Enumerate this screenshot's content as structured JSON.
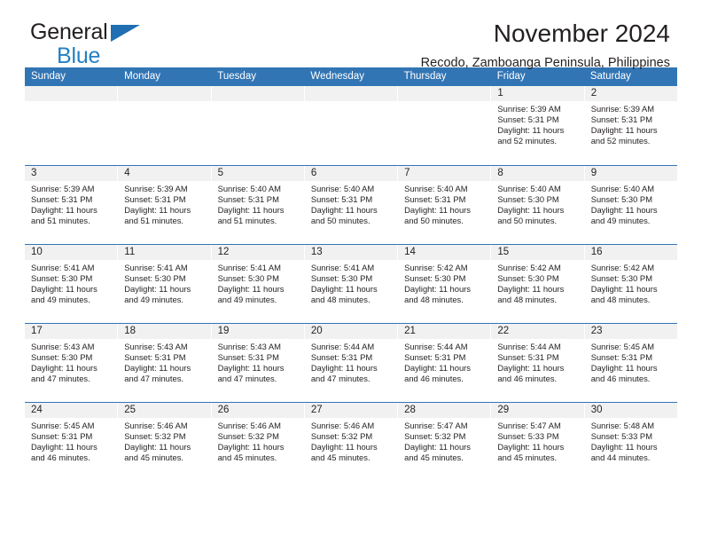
{
  "brand": {
    "line1": "General",
    "line2": "Blue",
    "flag_icon": "triangle-flag-icon",
    "accent_color": "#2480c4"
  },
  "header": {
    "title": "November 2024",
    "subtitle": "Recodo, Zamboanga Peninsula, Philippines"
  },
  "calendar": {
    "header_bg": "#3275b5",
    "datebar_bg": "#f1f1f1",
    "weekday_headers": [
      "Sunday",
      "Monday",
      "Tuesday",
      "Wednesday",
      "Thursday",
      "Friday",
      "Saturday"
    ],
    "weeks": [
      [
        {
          "day": "",
          "empty": true
        },
        {
          "day": "",
          "empty": true
        },
        {
          "day": "",
          "empty": true
        },
        {
          "day": "",
          "empty": true
        },
        {
          "day": "",
          "empty": true
        },
        {
          "day": "1",
          "sunrise": "Sunrise: 5:39 AM",
          "sunset": "Sunset: 5:31 PM",
          "daylight": "Daylight: 11 hours and 52 minutes."
        },
        {
          "day": "2",
          "sunrise": "Sunrise: 5:39 AM",
          "sunset": "Sunset: 5:31 PM",
          "daylight": "Daylight: 11 hours and 52 minutes."
        }
      ],
      [
        {
          "day": "3",
          "sunrise": "Sunrise: 5:39 AM",
          "sunset": "Sunset: 5:31 PM",
          "daylight": "Daylight: 11 hours and 51 minutes."
        },
        {
          "day": "4",
          "sunrise": "Sunrise: 5:39 AM",
          "sunset": "Sunset: 5:31 PM",
          "daylight": "Daylight: 11 hours and 51 minutes."
        },
        {
          "day": "5",
          "sunrise": "Sunrise: 5:40 AM",
          "sunset": "Sunset: 5:31 PM",
          "daylight": "Daylight: 11 hours and 51 minutes."
        },
        {
          "day": "6",
          "sunrise": "Sunrise: 5:40 AM",
          "sunset": "Sunset: 5:31 PM",
          "daylight": "Daylight: 11 hours and 50 minutes."
        },
        {
          "day": "7",
          "sunrise": "Sunrise: 5:40 AM",
          "sunset": "Sunset: 5:31 PM",
          "daylight": "Daylight: 11 hours and 50 minutes."
        },
        {
          "day": "8",
          "sunrise": "Sunrise: 5:40 AM",
          "sunset": "Sunset: 5:30 PM",
          "daylight": "Daylight: 11 hours and 50 minutes."
        },
        {
          "day": "9",
          "sunrise": "Sunrise: 5:40 AM",
          "sunset": "Sunset: 5:30 PM",
          "daylight": "Daylight: 11 hours and 49 minutes."
        }
      ],
      [
        {
          "day": "10",
          "sunrise": "Sunrise: 5:41 AM",
          "sunset": "Sunset: 5:30 PM",
          "daylight": "Daylight: 11 hours and 49 minutes."
        },
        {
          "day": "11",
          "sunrise": "Sunrise: 5:41 AM",
          "sunset": "Sunset: 5:30 PM",
          "daylight": "Daylight: 11 hours and 49 minutes."
        },
        {
          "day": "12",
          "sunrise": "Sunrise: 5:41 AM",
          "sunset": "Sunset: 5:30 PM",
          "daylight": "Daylight: 11 hours and 49 minutes."
        },
        {
          "day": "13",
          "sunrise": "Sunrise: 5:41 AM",
          "sunset": "Sunset: 5:30 PM",
          "daylight": "Daylight: 11 hours and 48 minutes."
        },
        {
          "day": "14",
          "sunrise": "Sunrise: 5:42 AM",
          "sunset": "Sunset: 5:30 PM",
          "daylight": "Daylight: 11 hours and 48 minutes."
        },
        {
          "day": "15",
          "sunrise": "Sunrise: 5:42 AM",
          "sunset": "Sunset: 5:30 PM",
          "daylight": "Daylight: 11 hours and 48 minutes."
        },
        {
          "day": "16",
          "sunrise": "Sunrise: 5:42 AM",
          "sunset": "Sunset: 5:30 PM",
          "daylight": "Daylight: 11 hours and 48 minutes."
        }
      ],
      [
        {
          "day": "17",
          "sunrise": "Sunrise: 5:43 AM",
          "sunset": "Sunset: 5:30 PM",
          "daylight": "Daylight: 11 hours and 47 minutes."
        },
        {
          "day": "18",
          "sunrise": "Sunrise: 5:43 AM",
          "sunset": "Sunset: 5:31 PM",
          "daylight": "Daylight: 11 hours and 47 minutes."
        },
        {
          "day": "19",
          "sunrise": "Sunrise: 5:43 AM",
          "sunset": "Sunset: 5:31 PM",
          "daylight": "Daylight: 11 hours and 47 minutes."
        },
        {
          "day": "20",
          "sunrise": "Sunrise: 5:44 AM",
          "sunset": "Sunset: 5:31 PM",
          "daylight": "Daylight: 11 hours and 47 minutes."
        },
        {
          "day": "21",
          "sunrise": "Sunrise: 5:44 AM",
          "sunset": "Sunset: 5:31 PM",
          "daylight": "Daylight: 11 hours and 46 minutes."
        },
        {
          "day": "22",
          "sunrise": "Sunrise: 5:44 AM",
          "sunset": "Sunset: 5:31 PM",
          "daylight": "Daylight: 11 hours and 46 minutes."
        },
        {
          "day": "23",
          "sunrise": "Sunrise: 5:45 AM",
          "sunset": "Sunset: 5:31 PM",
          "daylight": "Daylight: 11 hours and 46 minutes."
        }
      ],
      [
        {
          "day": "24",
          "sunrise": "Sunrise: 5:45 AM",
          "sunset": "Sunset: 5:31 PM",
          "daylight": "Daylight: 11 hours and 46 minutes."
        },
        {
          "day": "25",
          "sunrise": "Sunrise: 5:46 AM",
          "sunset": "Sunset: 5:32 PM",
          "daylight": "Daylight: 11 hours and 45 minutes."
        },
        {
          "day": "26",
          "sunrise": "Sunrise: 5:46 AM",
          "sunset": "Sunset: 5:32 PM",
          "daylight": "Daylight: 11 hours and 45 minutes."
        },
        {
          "day": "27",
          "sunrise": "Sunrise: 5:46 AM",
          "sunset": "Sunset: 5:32 PM",
          "daylight": "Daylight: 11 hours and 45 minutes."
        },
        {
          "day": "28",
          "sunrise": "Sunrise: 5:47 AM",
          "sunset": "Sunset: 5:32 PM",
          "daylight": "Daylight: 11 hours and 45 minutes."
        },
        {
          "day": "29",
          "sunrise": "Sunrise: 5:47 AM",
          "sunset": "Sunset: 5:33 PM",
          "daylight": "Daylight: 11 hours and 45 minutes."
        },
        {
          "day": "30",
          "sunrise": "Sunrise: 5:48 AM",
          "sunset": "Sunset: 5:33 PM",
          "daylight": "Daylight: 11 hours and 44 minutes."
        }
      ]
    ]
  }
}
